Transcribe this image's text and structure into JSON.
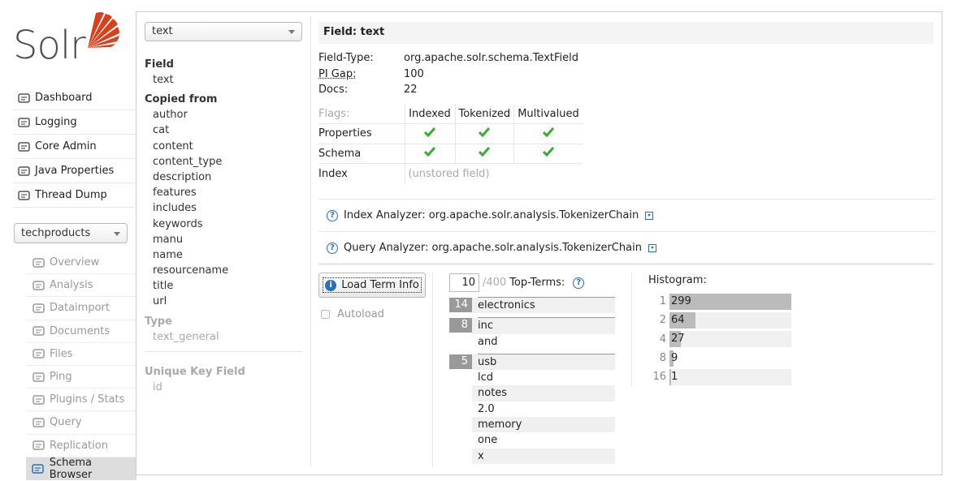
{
  "app": {
    "logo_text": "Solr"
  },
  "nav": [
    {
      "label": "Dashboard",
      "icon": "dashboard-icon"
    },
    {
      "label": "Logging",
      "icon": "logging-icon"
    },
    {
      "label": "Core Admin",
      "icon": "core-admin-icon"
    },
    {
      "label": "Java Properties",
      "icon": "java-properties-icon"
    },
    {
      "label": "Thread Dump",
      "icon": "thread-dump-icon"
    }
  ],
  "core_selector": {
    "value": "techproducts"
  },
  "core_nav": [
    {
      "label": "Overview",
      "icon": "overview-icon"
    },
    {
      "label": "Analysis",
      "icon": "analysis-icon"
    },
    {
      "label": "Dataimport",
      "icon": "dataimport-icon"
    },
    {
      "label": "Documents",
      "icon": "documents-icon"
    },
    {
      "label": "Files",
      "icon": "files-icon"
    },
    {
      "label": "Ping",
      "icon": "ping-icon"
    },
    {
      "label": "Plugins / Stats",
      "icon": "plugins-icon"
    },
    {
      "label": "Query",
      "icon": "query-icon"
    },
    {
      "label": "Replication",
      "icon": "replication-icon"
    },
    {
      "label": "Schema Browser",
      "icon": "schema-browser-icon",
      "active": true
    }
  ],
  "field_selector": {
    "value": "text"
  },
  "field_column": {
    "field_heading": "Field",
    "field_value": "text",
    "copied_heading": "Copied from",
    "copied": [
      "author",
      "cat",
      "content",
      "content_type",
      "description",
      "features",
      "includes",
      "keywords",
      "manu",
      "name",
      "resourcename",
      "title",
      "url"
    ],
    "type_heading": "Type",
    "type_value": "text_general",
    "unique_heading": "Unique Key Field",
    "unique_value": "id"
  },
  "detail": {
    "title": "Field: text",
    "field_type_label": "Field-Type:",
    "field_type": "org.apache.solr.schema.TextField",
    "pi_gap_label": "PI Gap:",
    "pi_gap": "100",
    "docs_label": "Docs:",
    "docs": "22",
    "flags_label": "Flags:",
    "flag_cols": [
      "Indexed",
      "Tokenized",
      "Multivalued"
    ],
    "properties_label": "Properties",
    "schema_label": "Schema",
    "index_label": "Index",
    "index_value": "(unstored field)"
  },
  "analyzers": {
    "index": "Index Analyzer: org.apache.solr.analysis.TokenizerChain",
    "query": "Query Analyzer: org.apache.solr.analysis.TokenizerChain"
  },
  "term_info": {
    "load_button": "Load Term Info",
    "autoload_label": "Autoload",
    "autoload_checked": false,
    "top_terms_count": "10",
    "top_terms_total": "/400",
    "top_terms_label": "Top-Terms:",
    "groups": [
      {
        "count": "14",
        "terms": [
          "electronics"
        ]
      },
      {
        "count": "8",
        "terms": [
          "inc",
          "and"
        ]
      },
      {
        "count": "5",
        "terms": [
          "usb",
          "lcd",
          "notes",
          "2.0",
          "memory",
          "one",
          "x"
        ]
      }
    ]
  },
  "histogram": {
    "title": "Histogram:",
    "rows": [
      {
        "key": "1",
        "value": "299",
        "fraction": 1.0
      },
      {
        "key": "2",
        "value": "64",
        "fraction": 0.214
      },
      {
        "key": "4",
        "value": "27",
        "fraction": 0.09
      },
      {
        "key": "8",
        "value": "9",
        "fraction": 0.03
      },
      {
        "key": "16",
        "value": "1",
        "fraction": 0.003
      }
    ]
  },
  "colors": {
    "accent": "#2a6fb7",
    "check": "#3aaa35",
    "logo": "#d9411e"
  }
}
